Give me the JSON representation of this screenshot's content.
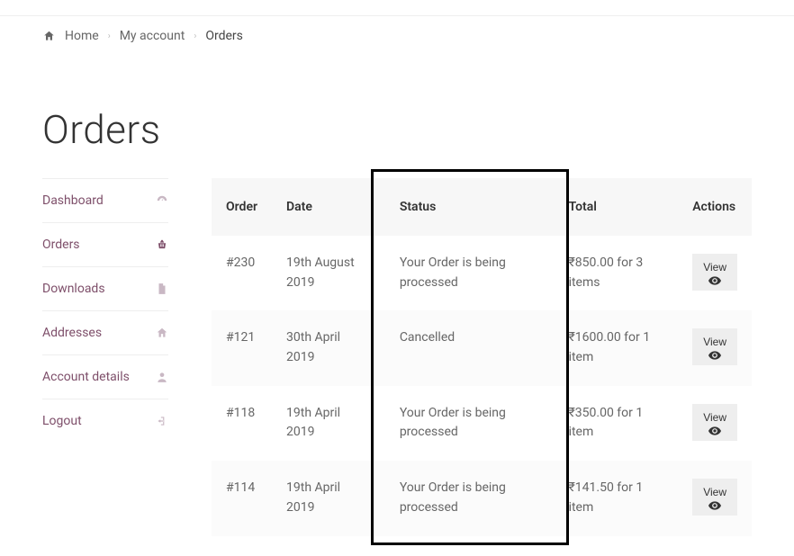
{
  "breadcrumb": {
    "home": "Home",
    "account": "My account",
    "current": "Orders"
  },
  "page_title": "Orders",
  "sidebar": {
    "items": [
      {
        "label": "Dashboard",
        "icon": "dashboard-icon"
      },
      {
        "label": "Orders",
        "icon": "basket-icon"
      },
      {
        "label": "Downloads",
        "icon": "file-icon"
      },
      {
        "label": "Addresses",
        "icon": "home-icon"
      },
      {
        "label": "Account details",
        "icon": "user-icon"
      },
      {
        "label": "Logout",
        "icon": "signout-icon"
      }
    ]
  },
  "table": {
    "headers": {
      "order": "Order",
      "date": "Date",
      "status": "Status",
      "total": "Total",
      "actions": "Actions"
    },
    "rows": [
      {
        "order": "#230",
        "date": "19th August 2019",
        "status": "Your Order is being processed",
        "total": "₹850.00 for 3 items",
        "action": "View"
      },
      {
        "order": "#121",
        "date": "30th April 2019",
        "status": "Cancelled",
        "total": "₹1600.00 for 1 item",
        "action": "View"
      },
      {
        "order": "#118",
        "date": "19th April 2019",
        "status": "Your Order is being processed",
        "total": "₹350.00 for 1 item",
        "action": "View"
      },
      {
        "order": "#114",
        "date": "19th April 2019",
        "status": "Your Order is being processed",
        "total": "₹141.50 for 1 item",
        "action": "View"
      }
    ]
  },
  "highlight_column": "status"
}
